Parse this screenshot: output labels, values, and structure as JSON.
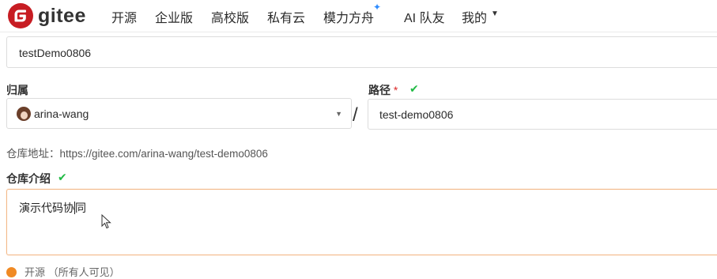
{
  "nav": {
    "brand": "gitee",
    "items": [
      "开源",
      "企业版",
      "高校版",
      "私有云",
      "模力方舟",
      "AI 队友",
      "我的"
    ]
  },
  "form": {
    "repo_name_value": "testDemo0806",
    "owner_label": "归属",
    "owner_value": "arina-wang",
    "path_label": "路径",
    "path_required": "*",
    "path_value": "test-demo0806",
    "separator": "/",
    "repo_url_hint": "仓库地址：https://gitee.com/arina-wang/test-demo0806",
    "desc_label": "仓库介绍",
    "desc_value_before": "演示代码协",
    "desc_value_after": "同",
    "visibility_partial": "开源  （所有人可见）"
  },
  "colors": {
    "brand": "#c71d23",
    "check": "#21ba45",
    "focus_border": "#f3b98a",
    "radio": "#f08a24"
  },
  "icons": {
    "logo": "gitee-logo-icon",
    "sparkle": "sparkle-icon",
    "check": "check-icon",
    "dropdown": "chevron-down-icon",
    "pointer": "mouse-pointer-icon"
  }
}
